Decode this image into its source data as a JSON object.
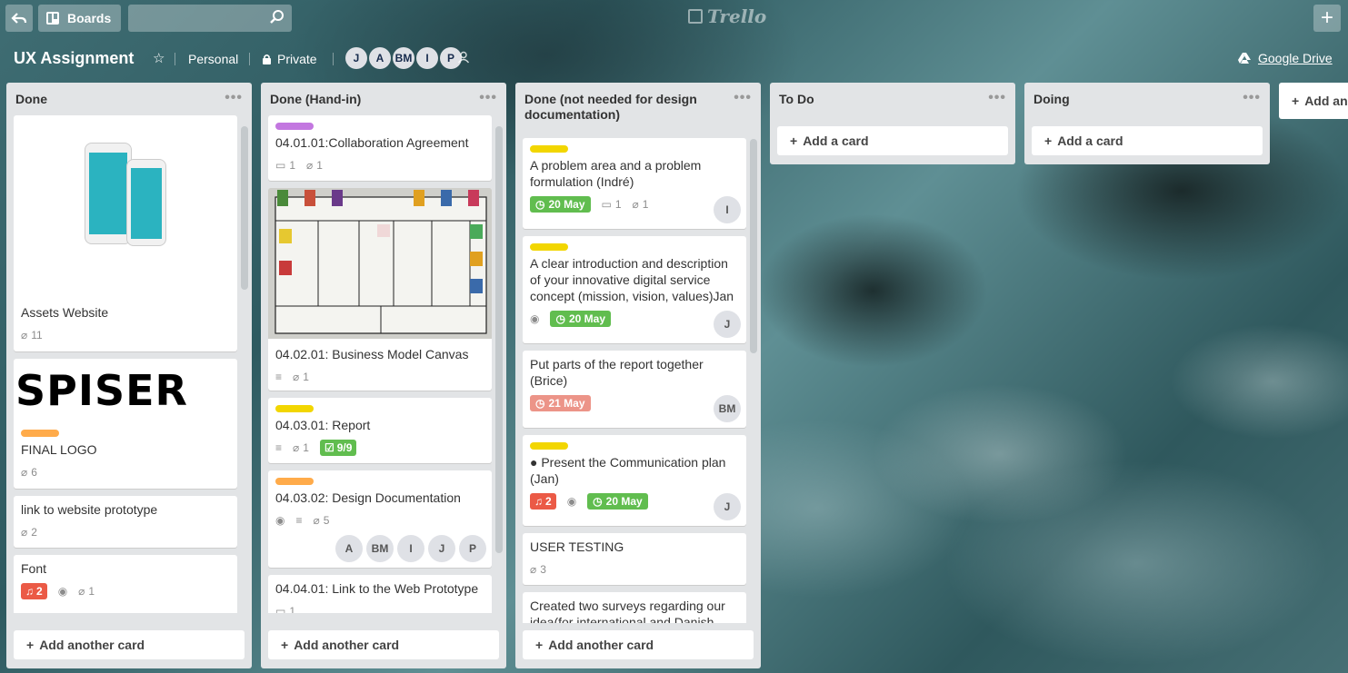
{
  "header": {
    "boards_label": "Boards",
    "logo_text": "Trello"
  },
  "board": {
    "title": "UX Assignment",
    "team": "Personal",
    "visibility": "Private",
    "members": [
      "J",
      "A",
      "BM",
      "I",
      "P"
    ],
    "gdrive": "Google Drive"
  },
  "lists": [
    {
      "title": "Done",
      "cards": [
        {
          "title": "Assets Website",
          "attachments": "11"
        },
        {
          "title": "FINAL LOGO",
          "logo_text": "SPISER",
          "attachments": "6",
          "label": "#ffab4a"
        },
        {
          "title": "link to website prototype",
          "attachments": "2"
        },
        {
          "title": "Font",
          "notifications": "2",
          "attachments": "1"
        }
      ],
      "add": "Add another card"
    },
    {
      "title": "Done (Hand-in)",
      "cards": [
        {
          "title": "04.01.01:Collaboration Agreement",
          "comments": "1",
          "attachments": "1",
          "label": "#c377e0"
        },
        {
          "title": "04.02.01: Business Model Canvas",
          "attachments": "1"
        },
        {
          "title": "04.03.01: Report",
          "attachments": "1",
          "checklist": "9/9",
          "label": "#f2d600"
        },
        {
          "title": "04.03.02: Design Documentation",
          "attachments": "5",
          "label": "#ffab4a",
          "members": [
            "A",
            "BM",
            "I",
            "J",
            "P"
          ]
        },
        {
          "title": "04.04.01: Link to the Web Prototype",
          "comments": "1"
        }
      ],
      "add": "Add another card"
    },
    {
      "title": "Done (not needed for design documentation)",
      "cards": [
        {
          "title": "A problem area and a problem formulation (Indré)",
          "due": "20 May",
          "comments": "1",
          "attachments": "1",
          "member": "I"
        },
        {
          "title": "A clear introduction and description of your innovative digital service concept (mission, vision, values)Jan",
          "due": "20 May",
          "member": "J"
        },
        {
          "title": "Put parts of the report together (Brice)",
          "due": "21 May",
          "member": "BM"
        },
        {
          "title": "● Present the Communication plan (Jan)",
          "notifications": "2",
          "due": "20 May",
          "member": "J"
        },
        {
          "title": "USER TESTING",
          "attachments": "3"
        },
        {
          "title": "Created two surveys regarding our idea(for international and Danish"
        }
      ],
      "add": "Add another card"
    },
    {
      "title": "To Do",
      "add": "Add a card"
    },
    {
      "title": "Doing",
      "add": "Add a card"
    }
  ],
  "add_list": "Add an",
  "colors": {
    "yellow": "#f2d600",
    "green": "#61bd4f",
    "red": "#eb5a46",
    "orange": "#ffab4a",
    "purple": "#c377e0"
  }
}
